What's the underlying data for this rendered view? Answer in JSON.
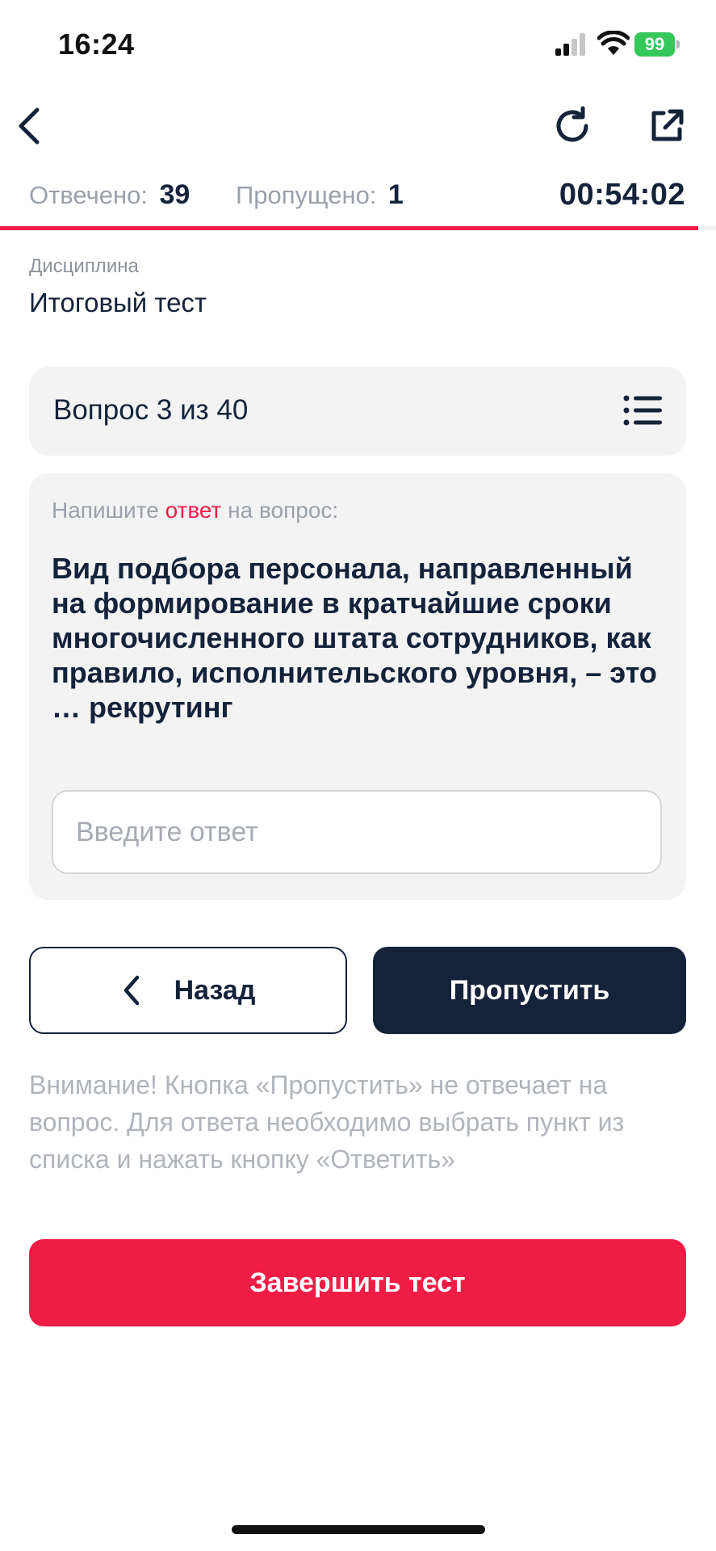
{
  "status_bar": {
    "time": "16:24",
    "battery": "99",
    "battery_color": "#34c759"
  },
  "nav": {
    "back_icon": "chevron-left-icon",
    "refresh_icon": "refresh-icon",
    "share_icon": "external-link-icon"
  },
  "stats": {
    "answered_label": "Отвечено:",
    "answered_value": "39",
    "skipped_label": "Пропущено:",
    "skipped_value": "1",
    "timer": "00:54:02",
    "progress_fraction": 0.975,
    "accent_color": "#ef1d46"
  },
  "discipline": {
    "label": "Дисциплина",
    "title": "Итоговый тест"
  },
  "question": {
    "counter": "Вопрос 3 из 40",
    "instruction_prefix": "Напишите ",
    "instruction_accent": "ответ",
    "instruction_suffix": " на вопрос:",
    "text": "Вид подбора персонала, направленный на формирование в кратчайшие сроки многочисленного штата сотрудников, как правило, исполнительского уровня, – это … рекрутинг",
    "input_value": "",
    "input_placeholder": "Введите ответ"
  },
  "buttons": {
    "back_label": "Назад",
    "skip_label": "Пропустить",
    "finish_label": "Завершить тест"
  },
  "notice": "Внимание! Кнопка «Пропустить» не отвечает на вопрос. Для ответа необходимо выбрать пункт из списка и нажать кнопку «Ответить»",
  "colors": {
    "primary_dark": "#14233a",
    "accent_red": "#ef1d46",
    "card_bg": "#f3f3f4"
  }
}
